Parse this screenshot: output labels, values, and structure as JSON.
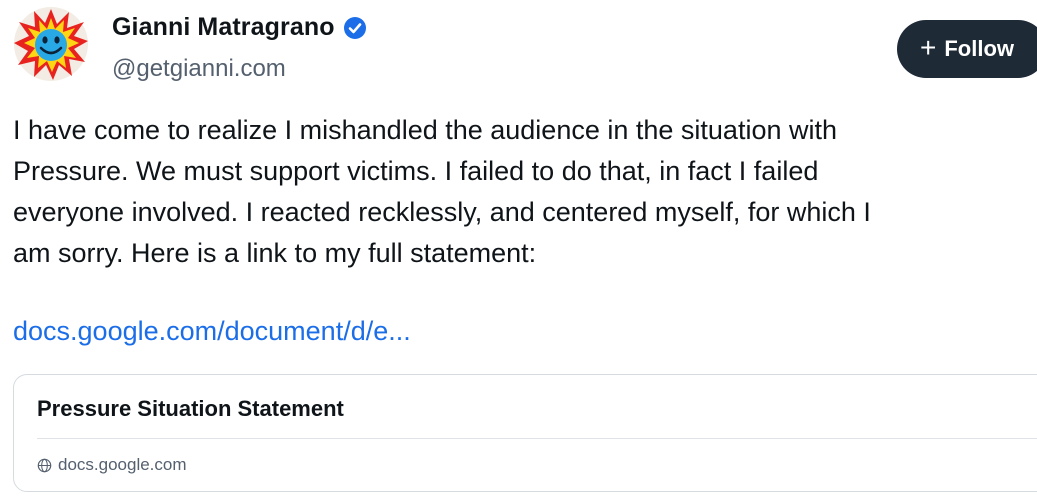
{
  "author": {
    "display_name": "Gianni Matragrano",
    "handle": "@getgianni.com",
    "verified": true,
    "avatar_icon": "smiley-burst-avatar"
  },
  "follow_button": {
    "label": "Follow",
    "icon": "plus-icon"
  },
  "post": {
    "lines": [
      "I have come to realize I mishandled the audience in the situation with",
      "Pressure. We must support victims. I failed to do that, in fact I failed",
      "everyone involved. I reacted recklessly, and centered myself, for which I",
      "am sorry. Here is a link to my full statement:"
    ],
    "link_text": "docs.google.com/document/d/e..."
  },
  "link_card": {
    "title": "Pressure Situation Statement",
    "domain": "docs.google.com",
    "domain_icon": "globe-icon"
  },
  "colors": {
    "text": "#0f1419",
    "secondary_text": "#55606e",
    "link": "#1b6ee8",
    "follow_bg": "#1f2a37",
    "verified_badge": "#1b6ee8",
    "card_border": "#d6dbe0"
  }
}
